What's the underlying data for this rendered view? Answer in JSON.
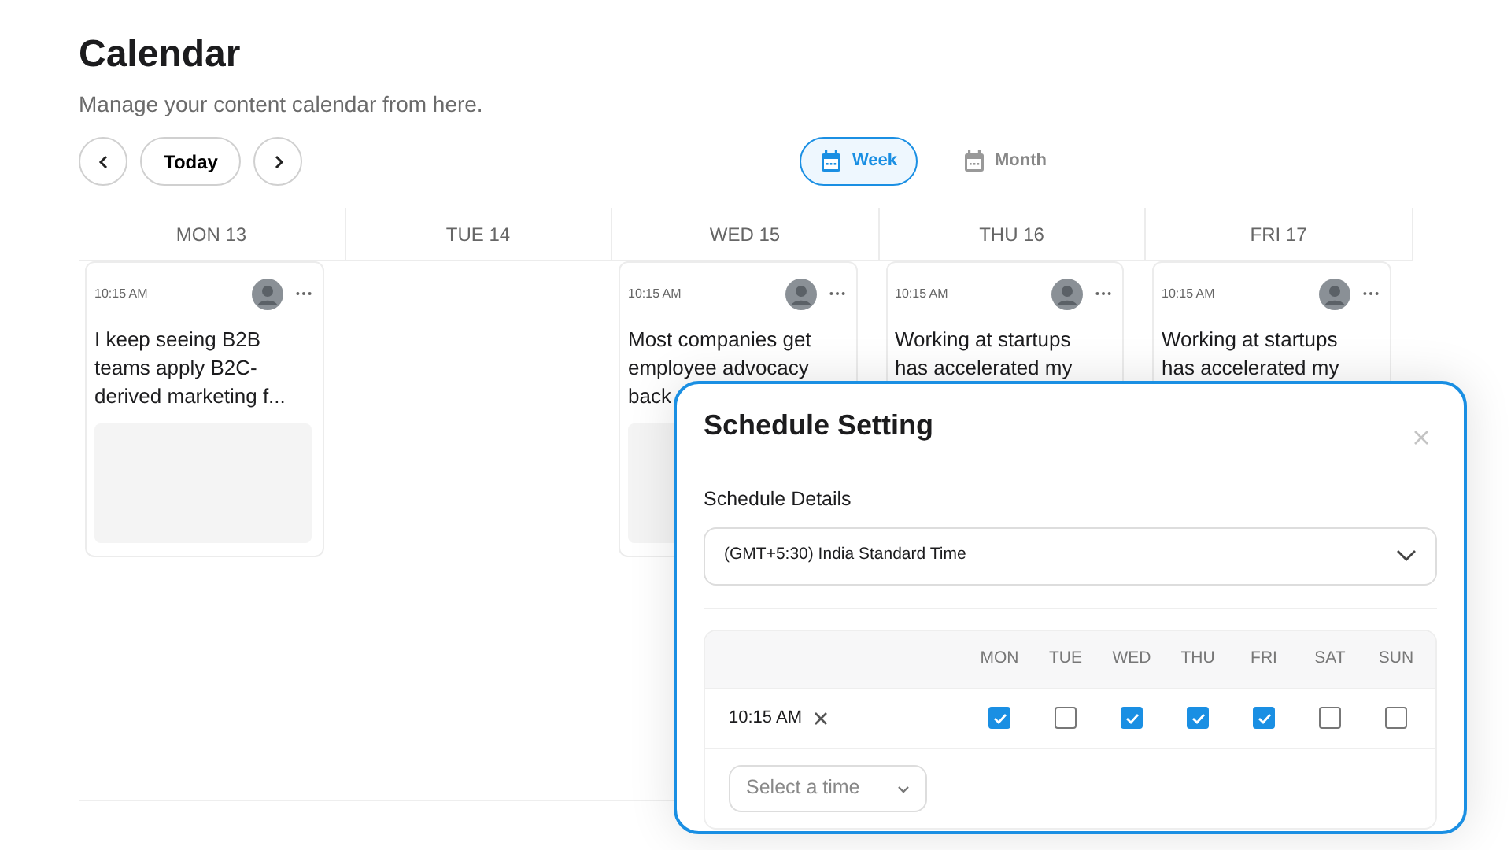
{
  "page": {
    "title": "Calendar",
    "subtitle": "Manage your content calendar from here."
  },
  "nav": {
    "today": "Today"
  },
  "views": [
    {
      "label": "Week",
      "selected": true
    },
    {
      "label": "Month",
      "selected": false
    }
  ],
  "days": [
    {
      "label": "MON 13",
      "posts": [
        {
          "time": "10:15 AM",
          "lines": [
            "I keep seeing B2B",
            "teams apply B2C-",
            "derived marketing f..."
          ],
          "has_media": true
        }
      ]
    },
    {
      "label": "TUE 14"
    },
    {
      "label": "WED 15",
      "posts": [
        {
          "time": "10:15 AM",
          "lines": [
            "Most companies get",
            "employee advocacy",
            "back"
          ],
          "has_media": true
        }
      ]
    },
    {
      "label": "THU 16",
      "posts": [
        {
          "time": "10:15 AM",
          "lines": [
            "Working at startups",
            "has accelerated my"
          ]
        }
      ]
    },
    {
      "label": "FRI 17",
      "posts": [
        {
          "time": "10:15 AM",
          "lines": [
            "Working at startups",
            "has accelerated my"
          ]
        }
      ]
    }
  ],
  "modal": {
    "title": "Schedule Setting",
    "section_label": "Schedule Details",
    "timezone": "(GMT+5:30) India Standard Time",
    "weekdays": [
      "MON",
      "TUE",
      "WED",
      "THU",
      "FRI",
      "SAT",
      "SUN"
    ],
    "slots": [
      {
        "time": "10:15 AM",
        "days": [
          {
            "checked": true
          },
          {
            "checked": false
          },
          {
            "checked": true
          },
          {
            "checked": true
          },
          {
            "checked": true
          },
          {
            "checked": false
          },
          {
            "checked": false
          }
        ]
      }
    ],
    "time_placeholder": "Select a time"
  }
}
